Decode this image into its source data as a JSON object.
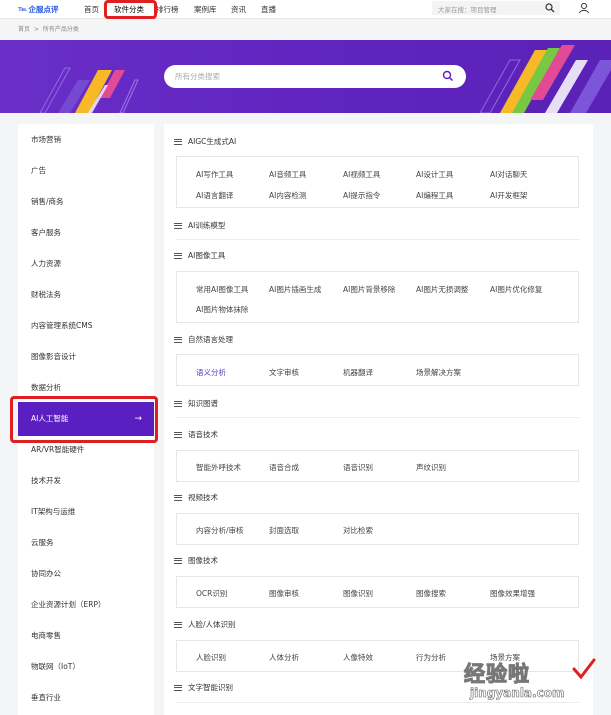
{
  "header": {
    "logo_text": "企服点评",
    "nav": [
      "首页",
      "软件分类",
      "排行榜",
      "案例库",
      "资讯",
      "直播"
    ],
    "search_placeholder": "大家在搜：项目管理"
  },
  "breadcrumb": [
    "首页",
    ">",
    "所有产品分类"
  ],
  "banner": {
    "search_placeholder": "所有分类搜索"
  },
  "sidebar": {
    "items": [
      "市场营销",
      "广告",
      "销售/商务",
      "客户服务",
      "人力资源",
      "财税法务",
      "内容管理系统CMS",
      "图像影音设计",
      "数据分析",
      "AI人工智能",
      "AR/VR智能硬件",
      "技术开发",
      "IT架构与运维",
      "云服务",
      "协同办公",
      "企业资源计划（ERP）",
      "电商零售",
      "物联网（IoT）",
      "垂直行业"
    ],
    "active_index": 9,
    "active_arrow": "→"
  },
  "sections": [
    {
      "title": "AIGC生成式AI",
      "rows": [
        [
          "AI写作工具",
          "AI音频工具",
          "AI视频工具",
          "AI设计工具",
          "AI对话聊天"
        ],
        [
          "AI语言翻译",
          "AI内容检测",
          "AI提示指令",
          "AI编程工具",
          "AI开发框架"
        ]
      ]
    },
    {
      "title": "AI训练模型",
      "rows": []
    },
    {
      "title": "AI图像工具",
      "rows": [
        [
          "常用AI图像工具",
          "AI图片插画生成",
          "AI图片背景移除",
          "AI图片无损调整",
          "AI图片优化修复"
        ],
        [
          "AI图片物体抹除"
        ]
      ]
    },
    {
      "title": "自然语言处理",
      "rows": [
        [
          "语义分析",
          "文字审核",
          "机器翻译",
          "场景解决方案"
        ]
      ]
    },
    {
      "title": "知识图谱",
      "rows": []
    },
    {
      "title": "语音技术",
      "rows": [
        [
          "智能外呼技术",
          "语音合成",
          "语音识别",
          "声纹识别"
        ]
      ]
    },
    {
      "title": "视频技术",
      "rows": [
        [
          "内容分析/审核",
          "封面选取",
          "对比检索"
        ]
      ]
    },
    {
      "title": "图像技术",
      "rows": [
        [
          "OCR识别",
          "图像审核",
          "图像识别",
          "图像搜索",
          "图像效果增强"
        ]
      ]
    },
    {
      "title": "人脸/人体识别",
      "rows": [
        [
          "人脸识别",
          "人体分析",
          "人像特效",
          "行为分析",
          "场景方案"
        ]
      ]
    },
    {
      "title": "文字智能识别",
      "rows": []
    }
  ],
  "watermark": {
    "line1": "经验啦",
    "line2": "jingyanla.com"
  },
  "colors": {
    "accent": "#5b1fc1",
    "highlight_border": "#e02020",
    "link_highlight": "#5b3fc1"
  }
}
